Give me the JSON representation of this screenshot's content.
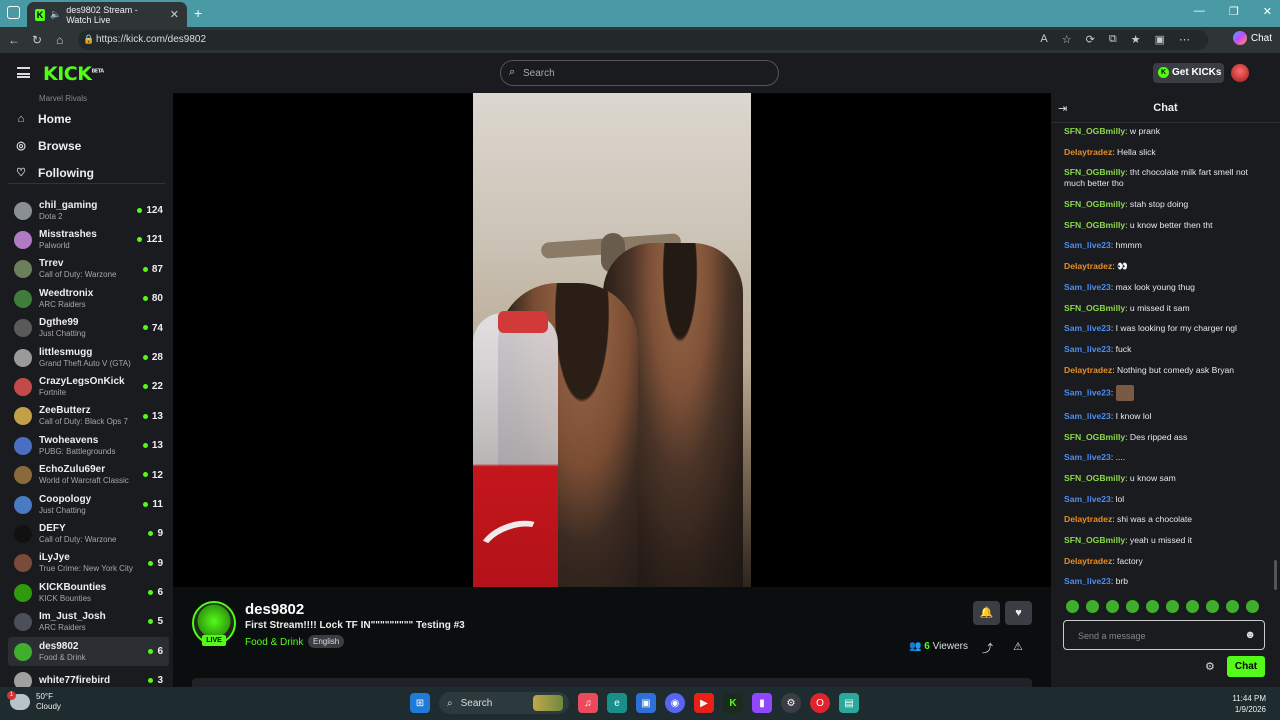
{
  "browser": {
    "tab_title": "des9802 Stream - Watch Live",
    "url": "https://kick.com/des9802",
    "copilot_label": "Chat"
  },
  "header": {
    "logo": "KICK",
    "logo_badge": "BETA",
    "search_placeholder": "Search",
    "get_kicks": "Get KICKs"
  },
  "sidebar": {
    "nav": [
      {
        "label": "Home",
        "icon": "home-icon"
      },
      {
        "label": "Browse",
        "icon": "compass-icon"
      },
      {
        "label": "Following",
        "icon": "heart-icon"
      }
    ],
    "cut_category": "Marvel Rivals",
    "following": [
      {
        "name": "chil_gaming",
        "category": "Dota 2",
        "viewers": "124",
        "color": "#8a8f96"
      },
      {
        "name": "Misstrashes",
        "category": "Palworld",
        "viewers": "121",
        "color": "#b07ac4"
      },
      {
        "name": "Trrev",
        "category": "Call of Duty: Warzone",
        "viewers": "87",
        "color": "#6b7f5a"
      },
      {
        "name": "Weedtronix",
        "category": "ARC Raiders",
        "viewers": "80",
        "color": "#3f7d3a"
      },
      {
        "name": "Dgthe99",
        "category": "Just Chatting",
        "viewers": "74",
        "color": "#5a5a5a"
      },
      {
        "name": "littlesmugg",
        "category": "Grand Theft Auto V (GTA)",
        "viewers": "28",
        "color": "#9a9a9a"
      },
      {
        "name": "CrazyLegsOnKick",
        "category": "Fortnite",
        "viewers": "22",
        "color": "#c24a4a"
      },
      {
        "name": "ZeeButterz",
        "category": "Call of Duty: Black Ops 7",
        "viewers": "13",
        "color": "#c2a04a"
      },
      {
        "name": "Twoheavens",
        "category": "PUBG: Battlegrounds",
        "viewers": "13",
        "color": "#4a6fc2"
      },
      {
        "name": "EchoZulu69er",
        "category": "World of Warcraft Classic",
        "viewers": "12",
        "color": "#8a6a3a"
      },
      {
        "name": "Coopology",
        "category": "Just Chatting",
        "viewers": "11",
        "color": "#4a7ac2"
      },
      {
        "name": "DEFY",
        "category": "Call of Duty: Warzone",
        "viewers": "9",
        "color": "#111111"
      },
      {
        "name": "iLyJye",
        "category": "True Crime: New York City",
        "viewers": "9",
        "color": "#7a4a3a"
      },
      {
        "name": "KICKBounties",
        "category": "KICK Bounties",
        "viewers": "6",
        "color": "#2f9a0e"
      },
      {
        "name": "Im_Just_Josh",
        "category": "ARC Raiders",
        "viewers": "5",
        "color": "#4a4f5a"
      },
      {
        "name": "des9802",
        "category": "Food & Drink",
        "viewers": "6",
        "color": "#3fae2c"
      },
      {
        "name": "white77firebird",
        "category": "",
        "viewers": "3",
        "color": "#a0a0a0"
      }
    ]
  },
  "stream": {
    "channel": "des9802",
    "title": "First Stream!!!! Lock TF IN\"\"\"\"\"\"\"\"\" Testing #3",
    "category": "Food & Drink",
    "language": "English",
    "live_badge": "LIVE",
    "viewers": "6",
    "viewers_label": "Viewers"
  },
  "chat": {
    "title": "Chat",
    "input_placeholder": "Send a message",
    "send_label": "Chat",
    "messages": [
      {
        "user": "SFN_OGBmilly",
        "text": "w prank",
        "color": "green"
      },
      {
        "user": "Delaytradez",
        "text": "Hella slick",
        "color": "orange"
      },
      {
        "user": "SFN_OGBmilly",
        "text": "tht chocolate milk fart smell not much better tho",
        "color": "green"
      },
      {
        "user": "SFN_OGBmilly",
        "text": "stah stop doing",
        "color": "green"
      },
      {
        "user": "SFN_OGBmilly",
        "text": "u know better then tht",
        "color": "green"
      },
      {
        "user": "Sam_live23",
        "text": "hmmm",
        "color": "blue"
      },
      {
        "user": "Delaytradez",
        "text": "👀",
        "color": "orange"
      },
      {
        "user": "Sam_live23",
        "text": "max look young thug",
        "color": "blue"
      },
      {
        "user": "SFN_OGBmilly",
        "text": "u missed it sam",
        "color": "green"
      },
      {
        "user": "Sam_live23",
        "text": "I was looking for my charger ngl",
        "color": "blue"
      },
      {
        "user": "Sam_live23",
        "text": "fuck",
        "color": "blue"
      },
      {
        "user": "Delaytradez",
        "text": "Nothing but comedy ask Bryan",
        "color": "orange"
      },
      {
        "user": "Sam_live23",
        "text": "",
        "color": "blue",
        "emote": true
      },
      {
        "user": "Sam_live23",
        "text": "I know lol",
        "color": "blue"
      },
      {
        "user": "SFN_OGBmilly",
        "text": "Des ripped ass",
        "color": "green"
      },
      {
        "user": "Sam_live23",
        "text": "....",
        "color": "blue"
      },
      {
        "user": "SFN_OGBmilly",
        "text": "u know sam",
        "color": "green"
      },
      {
        "user": "Sam_live23",
        "text": "lol",
        "color": "blue"
      },
      {
        "user": "Delaytradez",
        "text": "shi was a chocolate",
        "color": "orange"
      },
      {
        "user": "SFN_OGBmilly",
        "text": "yeah u missed it",
        "color": "green"
      },
      {
        "user": "Delaytradez",
        "text": "factory",
        "color": "orange"
      },
      {
        "user": "Sam_live23",
        "text": "brb",
        "color": "blue"
      }
    ]
  },
  "taskbar": {
    "temp": "50°F",
    "condition": "Cloudy",
    "search": "Search",
    "time": "11:44 PM",
    "date": "1/9/2026"
  }
}
